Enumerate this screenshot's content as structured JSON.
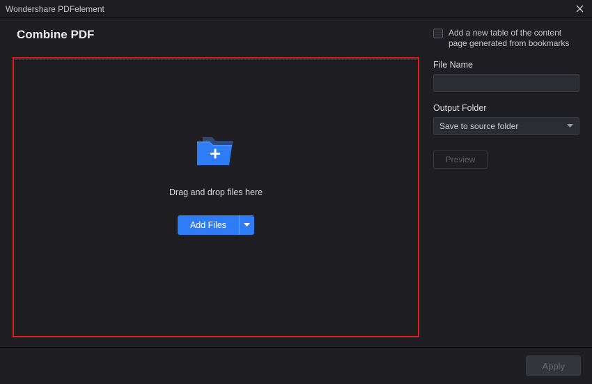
{
  "titlebar": {
    "app_title": "Wondershare PDFelement"
  },
  "page": {
    "title": "Combine PDF"
  },
  "dropzone": {
    "hint": "Drag and drop files here",
    "add_button_label": "Add Files"
  },
  "sidebar": {
    "checkbox_label": "Add a new table of the content page generated from bookmarks",
    "file_name_label": "File Name",
    "file_name_value": "",
    "output_folder_label": "Output Folder",
    "output_folder_selected": "Save to source folder",
    "preview_label": "Preview"
  },
  "footer": {
    "apply_label": "Apply"
  },
  "colors": {
    "accent": "#2f7df6",
    "highlight_border": "#e21b1b"
  }
}
